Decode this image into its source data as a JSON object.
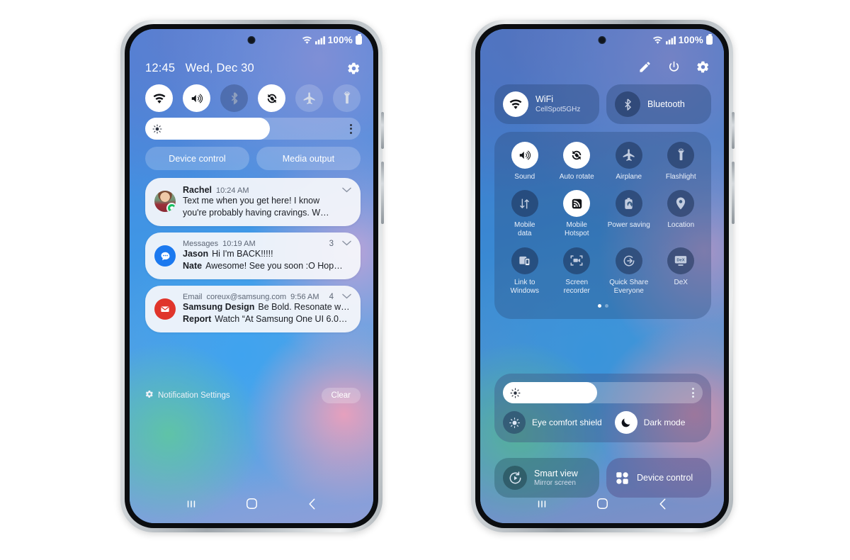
{
  "left_phone": {
    "status": {
      "battery": "100%",
      "wifi": "wifi-icon",
      "signal": "signal-icon"
    },
    "header": {
      "time": "12:45",
      "date": "Wed, Dec 30",
      "settings_icon": "gear-icon"
    },
    "quick_toggles": [
      {
        "name": "wifi",
        "state": "on"
      },
      {
        "name": "sound",
        "state": "on"
      },
      {
        "name": "bluetooth",
        "state": "off"
      },
      {
        "name": "auto-rotate",
        "state": "on"
      },
      {
        "name": "airplane",
        "state": "off"
      },
      {
        "name": "flashlight",
        "state": "off"
      }
    ],
    "brightness": {
      "value": 58
    },
    "pills": [
      {
        "label": "Device control"
      },
      {
        "label": "Media output"
      }
    ],
    "notifications": [
      {
        "type": "person",
        "title": "Rachel",
        "time": "10:24 AM",
        "count": "",
        "line1": "Text me when you get here! I know",
        "line2": "you're probably having cravings. W…",
        "line1_sender": "",
        "line2_sender": ""
      },
      {
        "type": "messages",
        "title": "Messages",
        "time": "10:19 AM",
        "count": "3",
        "line1_sender": "Jason",
        "line1": "Hi I'm BACK!!!!!",
        "line2_sender": "Nate",
        "line2": "Awesome! See you soon :O Hop…"
      },
      {
        "type": "email",
        "title": "Email",
        "subtitle": "coreux@samsung.com",
        "time": "9:56 AM",
        "count": "4",
        "line1_sender": "Samsung Design",
        "line1": "Be Bold. Resonate w…",
        "line2_sender": "Report",
        "line2": "Watch “At Samsung One UI 6.0…"
      }
    ],
    "footer": {
      "settings_label": "Notification Settings",
      "clear_label": "Clear"
    },
    "navbar": [
      "recents-icon",
      "home-icon",
      "back-icon"
    ]
  },
  "right_phone": {
    "status": {
      "battery": "100%"
    },
    "header_icons": [
      "pencil-icon",
      "power-icon",
      "gear-icon"
    ],
    "big_cards": [
      {
        "label": "WiFi",
        "sublabel": "CellSpot5GHz",
        "state": "on",
        "icon": "wifi-icon"
      },
      {
        "label": "Bluetooth",
        "sublabel": "",
        "state": "off",
        "icon": "bluetooth-icon"
      }
    ],
    "grid": [
      {
        "label": "Sound",
        "icon": "sound-icon",
        "state": "on"
      },
      {
        "label": "Auto rotate",
        "icon": "auto-rotate-icon",
        "state": "on"
      },
      {
        "label": "Airplane",
        "icon": "airplane-icon",
        "state": "off"
      },
      {
        "label": "Flashlight",
        "icon": "flashlight-icon",
        "state": "off"
      },
      {
        "label": "Mobile\ndata",
        "icon": "mobile-data-icon",
        "state": "off"
      },
      {
        "label": "Mobile\nHotspot",
        "icon": "hotspot-icon",
        "state": "on"
      },
      {
        "label": "Power saving",
        "icon": "power-saving-icon",
        "state": "off"
      },
      {
        "label": "Location",
        "icon": "location-icon",
        "state": "off"
      },
      {
        "label": "Link to\nWindows",
        "icon": "link-to-windows-icon",
        "state": "off"
      },
      {
        "label": "Screen\nrecorder",
        "icon": "screen-recorder-icon",
        "state": "off"
      },
      {
        "label": "Quick Share\nEveryone",
        "icon": "quick-share-icon",
        "state": "off"
      },
      {
        "label": "DeX",
        "icon": "dex-icon",
        "state": "off"
      }
    ],
    "page_dots": {
      "count": 2,
      "active": 0
    },
    "brightness": {
      "value": 47
    },
    "modes": [
      {
        "label": "Eye comfort shield",
        "state": "off",
        "icon": "eye-comfort-icon"
      },
      {
        "label": "Dark mode",
        "state": "on",
        "icon": "moon-icon"
      }
    ],
    "bottom_cards": [
      {
        "label": "Smart view",
        "sublabel": "Mirror screen",
        "icon": "smart-view-icon"
      },
      {
        "label": "Device control",
        "sublabel": "",
        "icon": "device-control-icon"
      }
    ],
    "navbar": [
      "recents-icon",
      "home-icon",
      "back-icon"
    ]
  },
  "colors": {
    "accent_on": "#ffffff",
    "messages_blue": "#1b79ef",
    "mail_red": "#e0352b",
    "badge_green": "#17c062"
  }
}
